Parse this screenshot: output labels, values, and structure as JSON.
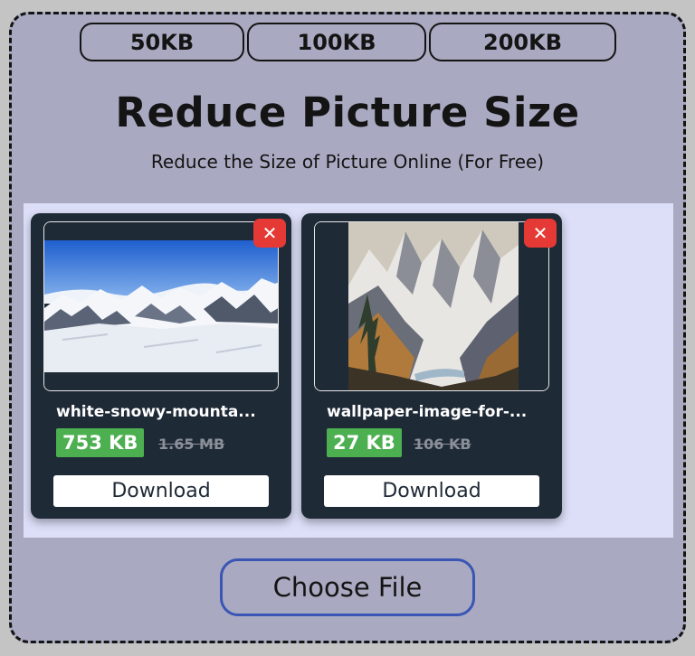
{
  "size_options": [
    "50KB",
    "100KB",
    "200KB"
  ],
  "header": {
    "title": "Reduce Picture Size",
    "subtitle": "Reduce the Size of Picture Online (For Free)"
  },
  "files": [
    {
      "name": "white-snowy-mounta...",
      "new_size": "753 KB",
      "old_size": "1.65 MB",
      "download_label": "Download",
      "close_label": "✕"
    },
    {
      "name": "wallpaper-image-for-...",
      "new_size": "27 KB",
      "old_size": "106 KB",
      "download_label": "Download",
      "close_label": "✕"
    }
  ],
  "choose_file_label": "Choose File",
  "colors": {
    "panel_bg": "#a9aac1",
    "drop_area_bg": "#dddff9",
    "card_bg": "#1f2a37",
    "size_badge": "#4caf50",
    "close_button": "#e53935",
    "choose_border": "#3a55b4"
  }
}
